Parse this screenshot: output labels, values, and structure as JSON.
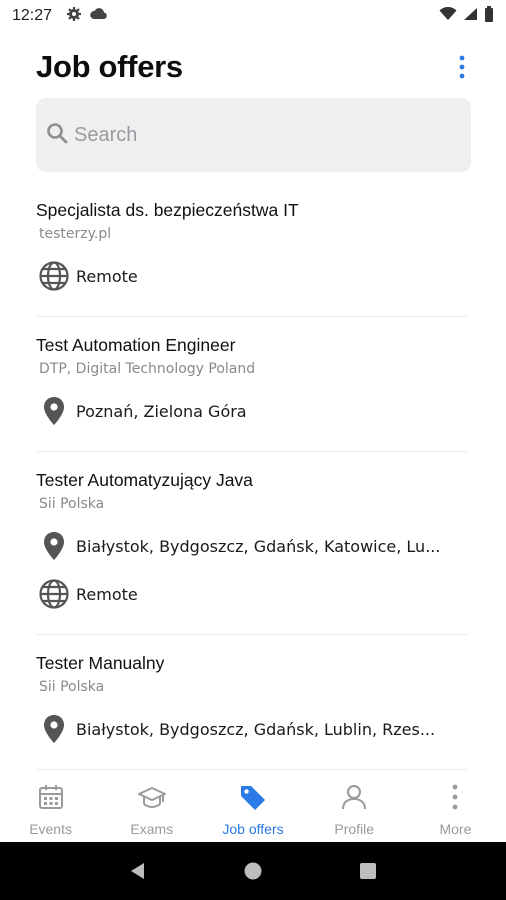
{
  "status_bar": {
    "time": "12:27"
  },
  "header": {
    "title": "Job offers"
  },
  "search": {
    "placeholder": "Search"
  },
  "jobs": [
    {
      "title": "Specjalista ds. bezpieczeństwa IT",
      "company": "testerzy.pl",
      "locations": [
        {
          "icon": "globe-icon",
          "text": "Remote"
        }
      ]
    },
    {
      "title": "Test Automation Engineer",
      "company": "DTP, Digital Technology Poland",
      "locations": [
        {
          "icon": "map-pin-icon",
          "text": "Poznań, Zielona Góra"
        }
      ]
    },
    {
      "title": "Tester Automatyzujący Java",
      "company": "Sii Polska",
      "locations": [
        {
          "icon": "map-pin-icon",
          "text": "Białystok, Bydgoszcz, Gdańsk, Katowice, Lu..."
        },
        {
          "icon": "globe-icon",
          "text": "Remote"
        }
      ]
    },
    {
      "title": "Tester Manualny",
      "company": "Sii Polska",
      "locations": [
        {
          "icon": "map-pin-icon",
          "text": "Białystok, Bydgoszcz, Gdańsk, Lublin, Rzes..."
        }
      ]
    }
  ],
  "tabbar": {
    "active": "Job offers",
    "accent_color": "#2b7be6",
    "tabs": [
      {
        "label": "Events",
        "icon": "calendar-icon"
      },
      {
        "label": "Exams",
        "icon": "graduation-cap-icon"
      },
      {
        "label": "Job offers",
        "icon": "tag-icon"
      },
      {
        "label": "Profile",
        "icon": "person-icon"
      },
      {
        "label": "More",
        "icon": "more-vertical-icon"
      }
    ]
  }
}
